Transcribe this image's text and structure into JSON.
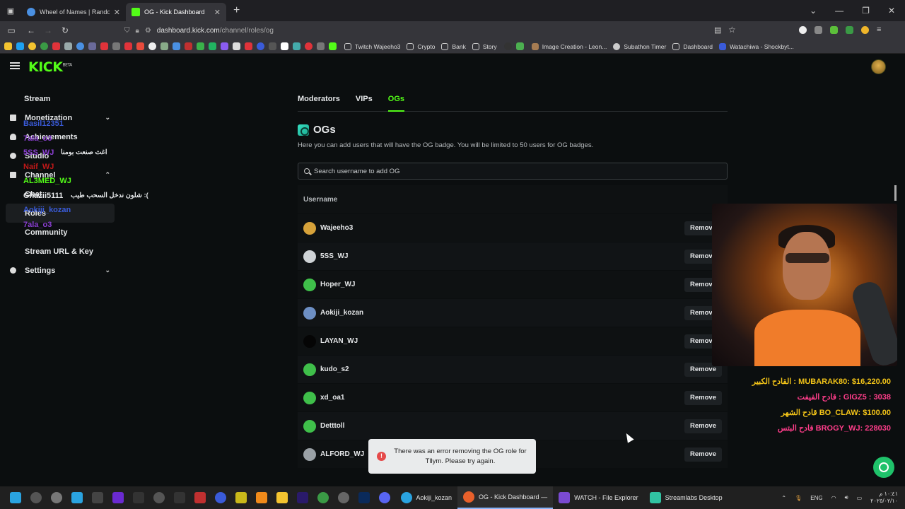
{
  "browser": {
    "tabs": [
      {
        "title": "Wheel of Names | Random nam",
        "fav_color": "#4a90e2",
        "active": false
      },
      {
        "title": "OG - Kick Dashboard",
        "fav_color": "#53fc18",
        "active": true
      }
    ],
    "url": {
      "host": "dashboard.kick.com",
      "path": "/channel/roles/og"
    },
    "bookmarks": [
      {
        "label": "Twitch Wajeeho3"
      },
      {
        "label": "Crypto"
      },
      {
        "label": "Bank"
      },
      {
        "label": "Story"
      },
      {
        "label": "Image Creation - Leon..."
      },
      {
        "label": "Subathon Timer"
      },
      {
        "label": "Dashboard"
      },
      {
        "label": "Watachiwa - Shockbyt..."
      }
    ]
  },
  "app": {
    "logo": "KICK",
    "logo_sup": "BETA"
  },
  "sidebar": {
    "items": [
      {
        "label": "Stream",
        "icon": "none"
      },
      {
        "label": "Monetization",
        "icon": "dollar-icon",
        "chevron": true
      },
      {
        "label": "Achievements",
        "icon": "trophy-icon"
      },
      {
        "label": "Studio",
        "icon": "camera-icon"
      },
      {
        "label": "Channel",
        "icon": "user-icon",
        "chevron": true
      },
      {
        "label": "Chat",
        "sub": true
      },
      {
        "label": "Roles",
        "sub": true,
        "active": true
      },
      {
        "label": "Community",
        "sub": true
      },
      {
        "label": "Stream URL & Key",
        "sub": true
      },
      {
        "label": "Settings",
        "icon": "gear-icon",
        "chevron": true
      }
    ]
  },
  "overlay_chat": [
    {
      "text": "Basil12351",
      "color": "#3a5bd9"
    },
    {
      "text": "7ala_o3",
      "color": "#8a3fd1"
    },
    {
      "text": "5SS_WJ",
      "color": "#8a3fd1"
    },
    {
      "text": "اغث صنعت بومنا",
      "color": "#e6e8ea"
    },
    {
      "text": "Naif_WJ",
      "color": "#c01818"
    },
    {
      "text": "AL3MED_WJ",
      "color": "#53fc18"
    },
    {
      "text": "Ghazii5111",
      "color": "#e6e8ea"
    },
    {
      "text": "شلون ندخل السحب طيب :(",
      "color": "#e6e8ea"
    },
    {
      "text": "Aokiji_kozan",
      "color": "#3a5bd9"
    },
    {
      "text": "7ala_o3",
      "color": "#8a3fd1"
    }
  ],
  "main": {
    "tabs": [
      {
        "label": "Moderators",
        "active": false
      },
      {
        "label": "VIPs",
        "active": false
      },
      {
        "label": "OGs",
        "active": true
      }
    ],
    "title": "OGs",
    "description": "Here you can add users that will have the OG badge. You will be limited to 50 users for OG badges.",
    "search_placeholder": "Search username to add OG",
    "column_header": "Username",
    "remove_label": "Remove",
    "rows": [
      {
        "username": "Wajeeho3",
        "avatar_color": "#d6a23a"
      },
      {
        "username": "5SS_WJ",
        "avatar_color": "#cfd3d6"
      },
      {
        "username": "Hoper_WJ",
        "avatar_color": "#3fbf4a"
      },
      {
        "username": "Aokiji_kozan",
        "avatar_color": "#6d8fc4"
      },
      {
        "username": "LAYAN_WJ",
        "avatar_color": "#050505"
      },
      {
        "username": "kudo_s2",
        "avatar_color": "#3fbf4a"
      },
      {
        "username": "xd_oa1",
        "avatar_color": "#3fbf4a"
      },
      {
        "username": "Detttoll",
        "avatar_color": "#3fbf4a"
      },
      {
        "username": "ALFORD_WJ",
        "avatar_color": "#9aa1a6"
      }
    ]
  },
  "toast": {
    "message": "There was an error removing the OG role for Tllym. Please try again.",
    "icon": "error-icon"
  },
  "stream_overlay": {
    "donors": [
      {
        "text": "القادح الكبير : MUBARAK80: $16,220.00",
        "color": "#f2c318"
      },
      {
        "text": "قادح الفيفت : GIGZ5 : 3038",
        "color": "#ff3d8a"
      },
      {
        "text": "قادح الشهر BO_CLAW: $100.00",
        "color": "#f2c318"
      },
      {
        "text": "قادح البتس BROGY_WJ: 228030",
        "color": "#ff3d8a"
      }
    ]
  },
  "taskbar": {
    "apps": [
      {
        "label": "Aokiji_kozan",
        "color": "#2aa3e0"
      },
      {
        "label": "OG - Kick Dashboard —",
        "color": "#e8602b",
        "active": true
      },
      {
        "label": "WATCH - File Explorer",
        "color": "#7a4ad1"
      },
      {
        "label": "Streamlabs Desktop",
        "color": "#31c3a2"
      }
    ],
    "lang": "ENG",
    "time": "١٠:٤١ م",
    "date": "٢٠٢٥/٠٢/١٠"
  }
}
